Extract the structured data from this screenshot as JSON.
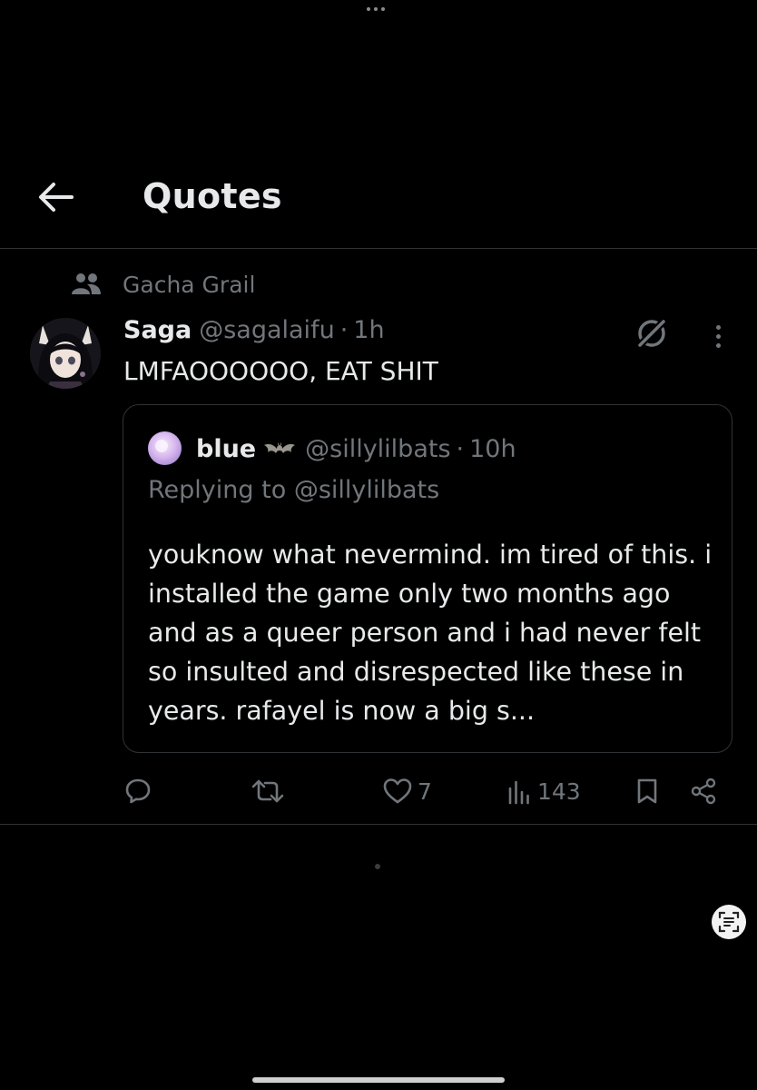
{
  "header": {
    "title": "Quotes"
  },
  "context": {
    "label": "Gacha Grail"
  },
  "post": {
    "author_name": "Saga",
    "author_handle": "@sagalaifu",
    "separator": "·",
    "time": "1h",
    "text": "LMFAOOOOOO, EAT SHIT"
  },
  "quote": {
    "author_name": "blue",
    "author_handle": "@sillylilbats",
    "separator": "·",
    "time": "10h",
    "replying_prefix": "Replying to",
    "replying_handle": "@sillylilbats",
    "text": "youknow what nevermind. im tired of this. i installed the game only two months ago and as a queer person and i had never felt so insulted and disrespected like these in years. rafayel is now a big s..."
  },
  "actions": {
    "likes": "7",
    "views": "143"
  },
  "colors": {
    "background": "#000000",
    "text_primary": "#e7e9ea",
    "text_secondary": "#71767b",
    "border": "#2f3336"
  }
}
